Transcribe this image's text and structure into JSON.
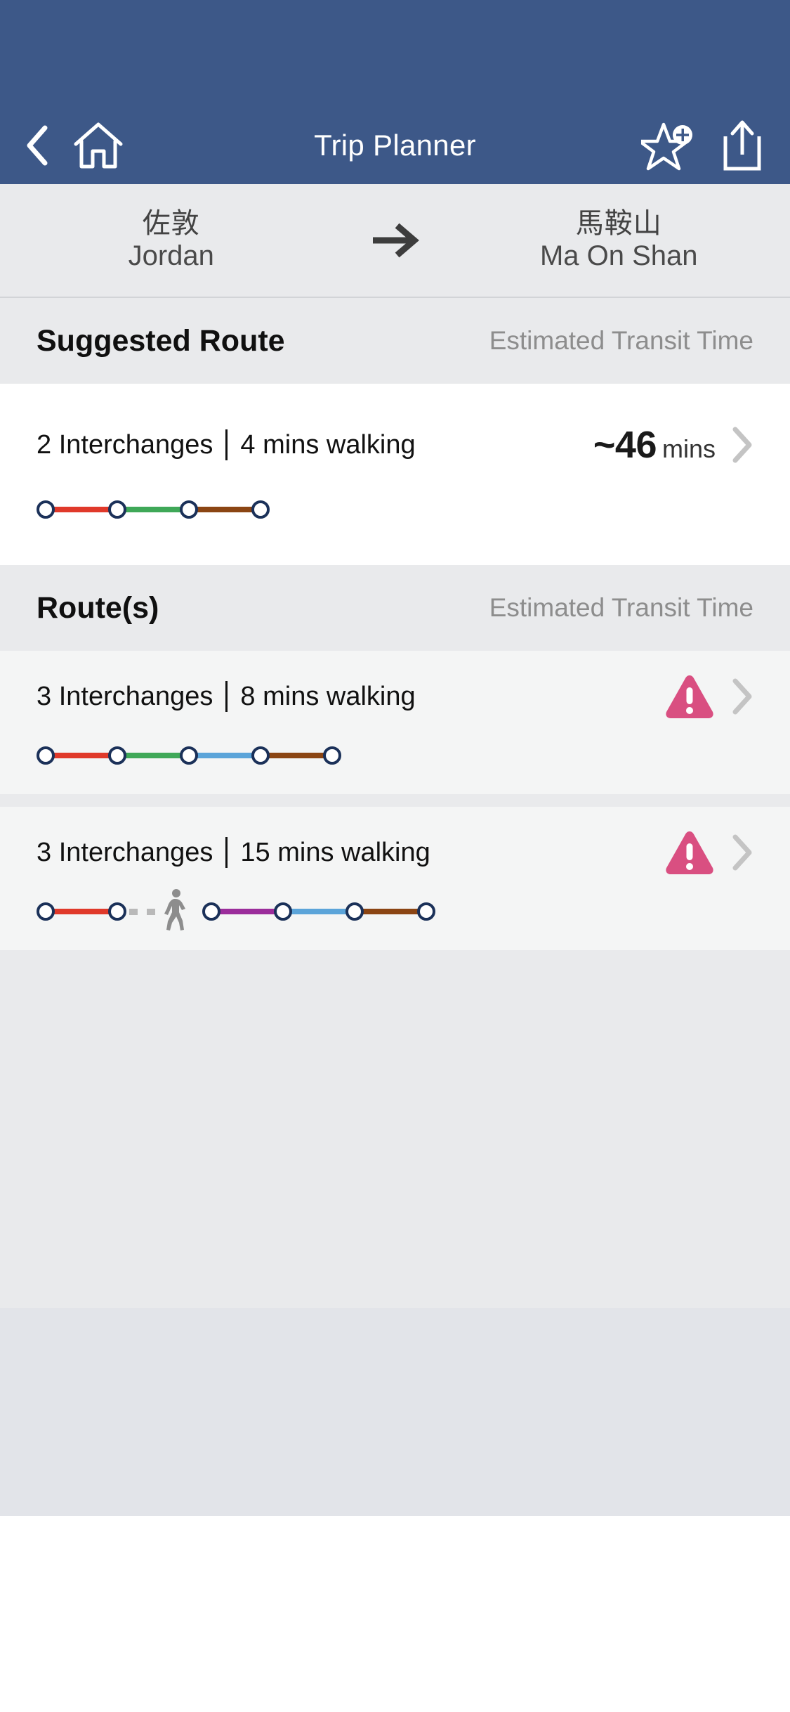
{
  "header": {
    "title": "Trip Planner",
    "back_icon": "chevron-left-icon",
    "home_icon": "home-icon",
    "favorite_icon": "star-plus-icon",
    "share_icon": "share-icon",
    "background_color": "#3d5888"
  },
  "trip": {
    "origin": {
      "zh": "佐敦",
      "en": "Jordan"
    },
    "arrow_icon": "arrow-right-icon",
    "destination": {
      "zh": "馬鞍山",
      "en": "Ma On Shan"
    }
  },
  "suggested_section": {
    "title": "Suggested Route",
    "subtitle": "Estimated Transit Time"
  },
  "suggested_route": {
    "interchanges": "2 Interchanges",
    "walking": "4 mins walking",
    "time_value": "~46",
    "time_unit": "mins",
    "chevron_icon": "chevron-right-icon",
    "line": {
      "nodes": 4,
      "segments": [
        {
          "type": "line",
          "color": "#e0392a",
          "length": 80
        },
        {
          "type": "line",
          "color": "#3fa858",
          "length": 80
        },
        {
          "type": "line",
          "color": "#8b4513",
          "length": 80
        }
      ]
    }
  },
  "routes_section": {
    "title": "Route(s)",
    "subtitle": "Estimated Transit Time"
  },
  "routes": [
    {
      "interchanges": "3 Interchanges",
      "walking": "8 mins walking",
      "warning_icon": "warning-triangle-icon",
      "chevron_icon": "chevron-right-icon",
      "line": {
        "nodes": 5,
        "segments": [
          {
            "type": "line",
            "color": "#e0392a",
            "length": 80
          },
          {
            "type": "line",
            "color": "#3fa858",
            "length": 80
          },
          {
            "type": "line",
            "color": "#5ba4d9",
            "length": 80
          },
          {
            "type": "line",
            "color": "#8b4513",
            "length": 80
          }
        ]
      }
    },
    {
      "interchanges": "3 Interchanges",
      "walking": "15 mins walking",
      "warning_icon": "warning-triangle-icon",
      "chevron_icon": "chevron-right-icon",
      "line": {
        "nodes": 6,
        "segments": [
          {
            "type": "line",
            "color": "#e0392a",
            "length": 80
          },
          {
            "type": "walk",
            "color": "#b9b9b9",
            "length": 100,
            "icon": "pedestrian-icon"
          },
          {
            "type": "line",
            "color": "#9b2d9b",
            "length": 80
          },
          {
            "type": "line",
            "color": "#5ba4d9",
            "length": 80
          },
          {
            "type": "line",
            "color": "#8b4513",
            "length": 80
          }
        ]
      }
    }
  ],
  "colors": {
    "nav_blue": "#3d5888",
    "warning_pink": "#d94f81",
    "node_stroke": "#1b3159",
    "card_bg": "#ffffff",
    "alt_row_bg": "#f4f5f5",
    "section_bg": "#e9eaec",
    "filler_bottom": "#e2e4e9"
  }
}
